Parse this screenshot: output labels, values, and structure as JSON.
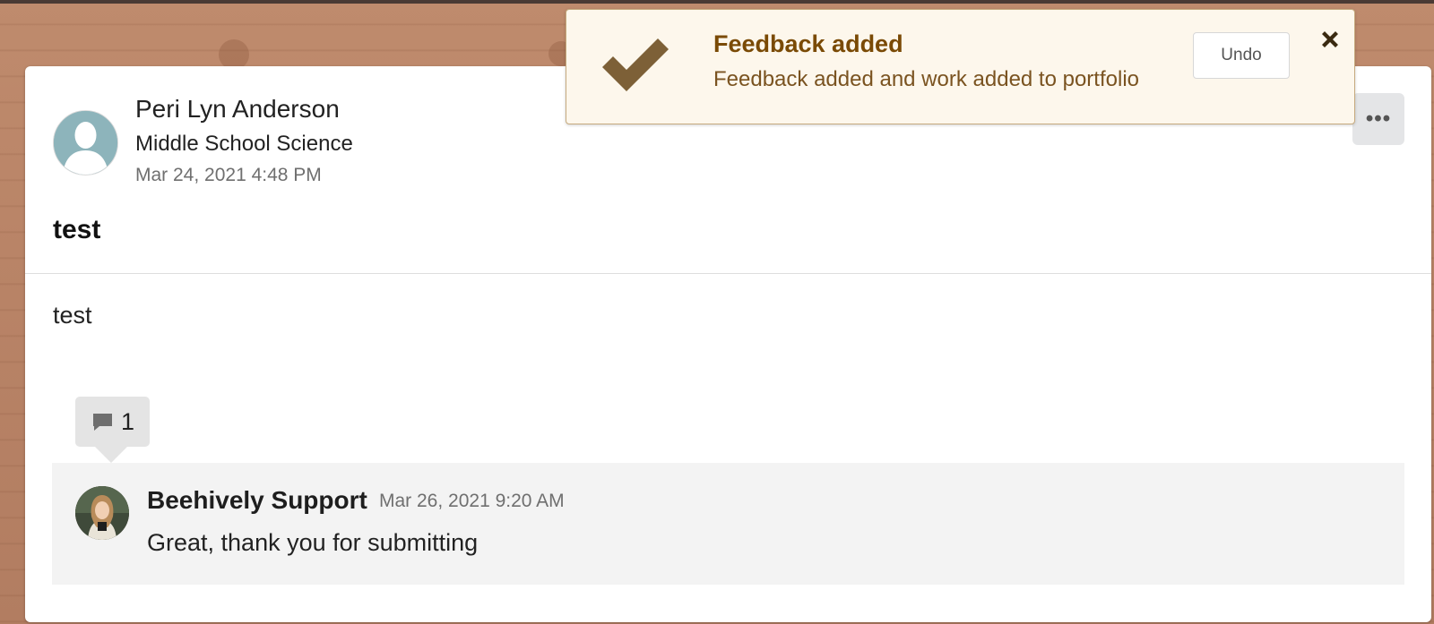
{
  "post": {
    "author_name": "Peri Lyn Anderson",
    "class_name": "Middle School Science",
    "timestamp": "Mar 24, 2021 4:48 PM",
    "title": "test",
    "body": "test",
    "more_icon": "more-horizontal-icon"
  },
  "comments": {
    "count": "1",
    "count_icon": "comment-icon",
    "items": [
      {
        "author": "Beehively Support",
        "timestamp": "Mar 26, 2021 9:20 AM",
        "text": "Great, thank you for submitting"
      }
    ]
  },
  "toast": {
    "title": "Feedback added",
    "message": "Feedback added and work added to portfolio",
    "undo_label": "Undo",
    "icon": "checkmark-icon",
    "close_icon": "close-icon"
  },
  "colors": {
    "toast_background": "#fdf7ec",
    "toast_title": "#7a4a05",
    "checkmark": "#7d6037",
    "avatar_placeholder": "#8db4bb"
  }
}
